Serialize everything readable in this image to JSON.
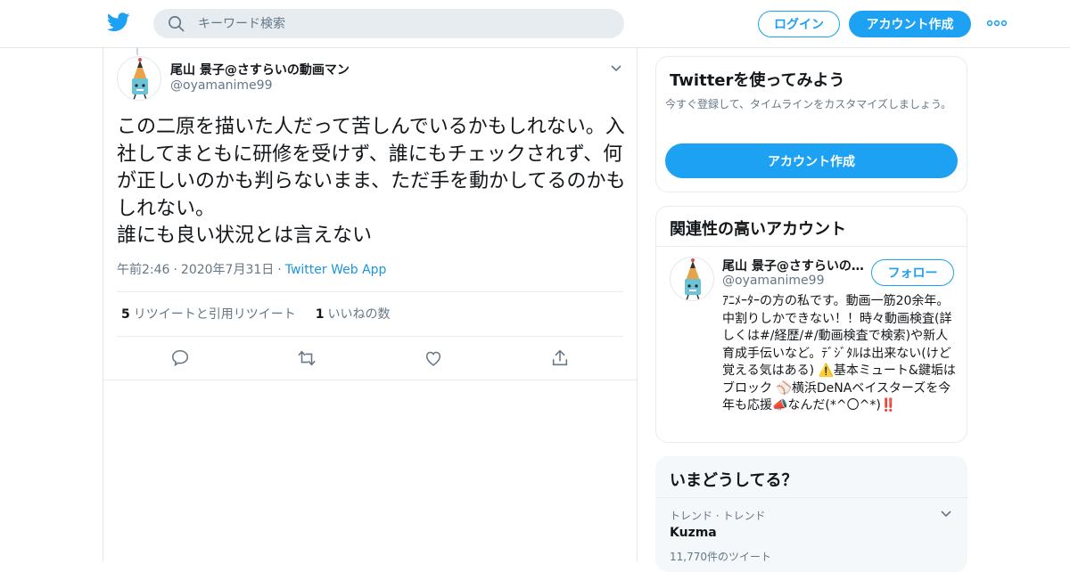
{
  "header": {
    "search_placeholder": "キーワード検索",
    "login_label": "ログイン",
    "signup_label": "アカウント作成"
  },
  "tweet": {
    "display_name": "尾山 景子@さすらいの動画マン",
    "handle": "@oyamanime99",
    "text": "この二原を描いた人だって苦しんでいるかもしれない。入社してまともに研修を受けず、誰にもチェックされず、何が正しいのかも判らないまま、ただ手を動かしてるのかもしれない。\n誰にも良い状況とは言えない",
    "time": "午前2:46",
    "date": "2020年7月31日",
    "app": "Twitter Web App",
    "sep": "·",
    "retweet_count": "5",
    "retweet_label": "リツイートと引用リツイート",
    "like_count": "1",
    "like_label": "いいねの数"
  },
  "signup_card": {
    "title": "Twitterを使ってみよう",
    "desc": "今すぐ登録して、タイムラインをカスタマイズしましょう。",
    "cta": "アカウント作成"
  },
  "related_card": {
    "title": "関連性の高いアカウント",
    "name": "尾山 景子@さすらいの動画マン",
    "handle": "@oyamanime99",
    "follow_label": "フォロー",
    "bio": "ｱﾆﾒｰﾀｰの方の私です。動画一筋20余年。中割りしかできない！！時々動画検査(詳しくは#/経歴/#/動画検査で検索)や新人育成手伝いなど。ﾃﾞｼﾞﾀﾙは出来ない(けど覚える気はある) ⚠️基本ミュート&鍵垢はブロック ⚾横浜DeNAベイスターズを今年も応援📣なんだ(*^〇^*)‼️"
  },
  "trends_card": {
    "title": "いまどうしてる？",
    "trend_meta": "トレンド · トレンド",
    "trend_name": "Kuzma",
    "trend_count": "11,770件のツイート"
  },
  "colors": {
    "accent": "#1da1f2",
    "secondary_text": "#657786",
    "border": "#e6ecf0"
  }
}
